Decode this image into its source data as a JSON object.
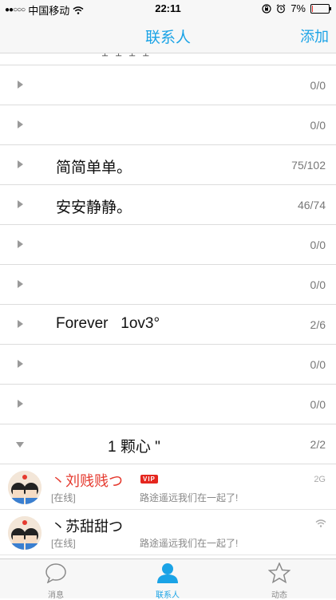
{
  "status_bar": {
    "signal_dots": "●●○○○",
    "carrier": "中国移动",
    "time": "22:11",
    "battery_percent": "7%",
    "battery_level": 0.07
  },
  "nav": {
    "title": "联系人",
    "add_label": "添加"
  },
  "groups": [
    {
      "name": "",
      "count": "0/0",
      "expanded": false
    },
    {
      "name": "",
      "count": "0/0",
      "expanded": false
    },
    {
      "name": "简简单单。",
      "count": "75/102",
      "expanded": false
    },
    {
      "name": "安安静静。",
      "count": "46/74",
      "expanded": false
    },
    {
      "name": "",
      "count": "0/0",
      "expanded": false
    },
    {
      "name": "",
      "count": "0/0",
      "expanded": false
    },
    {
      "name": "Forever   1ov3°",
      "count": "2/6",
      "expanded": false
    },
    {
      "name": "",
      "count": "0/0",
      "expanded": false
    },
    {
      "name": "",
      "count": "0/0",
      "expanded": false
    },
    {
      "name": "1 颗心 \"",
      "count": "2/2",
      "expanded": true
    }
  ],
  "contacts": [
    {
      "name": "丶刘贱贱つ",
      "vip": "VIP",
      "status": "[在线]",
      "signature": "路途遥远我们在一起了!",
      "network": "2G"
    },
    {
      "name": "丶苏甜甜つ",
      "status": "[在线]",
      "signature": "路途遥远我们在一起了!",
      "network_icon": "wifi-icon"
    }
  ],
  "tabs": [
    {
      "label": "消息",
      "icon": "chat-bubble-icon"
    },
    {
      "label": "联系人",
      "icon": "person-icon",
      "active": true
    },
    {
      "label": "动态",
      "icon": "star-icon"
    }
  ],
  "colors": {
    "accent": "#1aa3e6",
    "vip_red": "#e5261e"
  }
}
